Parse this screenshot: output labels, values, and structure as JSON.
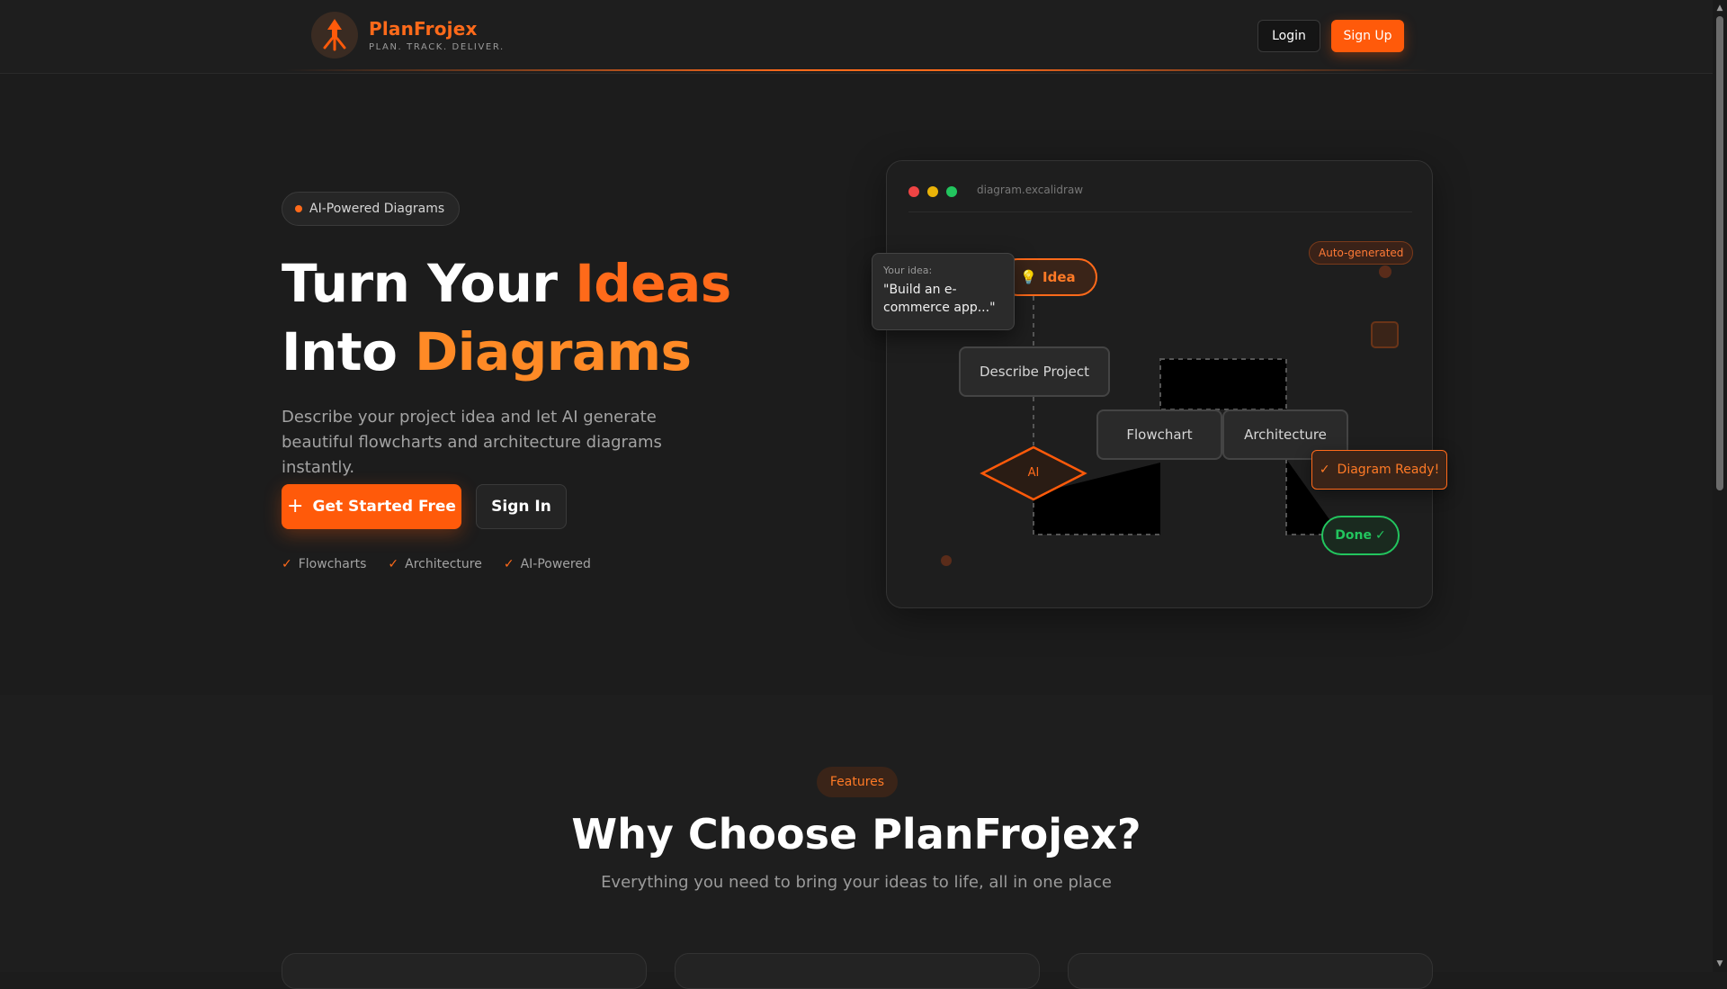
{
  "header": {
    "brand_name": "PlanFrojex",
    "tagline": "PLAN. TRACK. DELIVER.",
    "login_label": "Login",
    "signup_label": "Sign Up"
  },
  "hero": {
    "badge": "AI-Powered Diagrams",
    "title_line1_plain": "Turn Your ",
    "title_line1_accent": "Ideas",
    "title_line2_plain": "Into ",
    "title_line2_accent": "Diagrams",
    "description": "Describe your project idea and let AI generate beautiful flowcharts and architecture diagrams instantly.",
    "primary_cta": "Get Started Free",
    "secondary_cta": "Sign In",
    "checks": [
      "Flowcharts",
      "Architecture",
      "AI-Powered"
    ]
  },
  "diagram": {
    "filename": "diagram.excalidraw",
    "idea_node": "Idea",
    "tooltip_label": "Your idea:",
    "tooltip_text": "\"Build an e-commerce app...\"",
    "describe_node": "Describe Project",
    "ai_node": "AI",
    "flowchart_node": "Flowchart",
    "architecture_node": "Architecture",
    "auto_generated": "Auto-generated",
    "ready_label": "Diagram Ready!",
    "done_label": "Done"
  },
  "features": {
    "pill": "Features",
    "title": "Why Choose PlanFrojex?",
    "subtitle": "Everything you need to bring your ideas to life, all in one place"
  },
  "colors": {
    "accent": "#ff6a1a",
    "background": "#1c1c1c",
    "success": "#22c55e"
  }
}
